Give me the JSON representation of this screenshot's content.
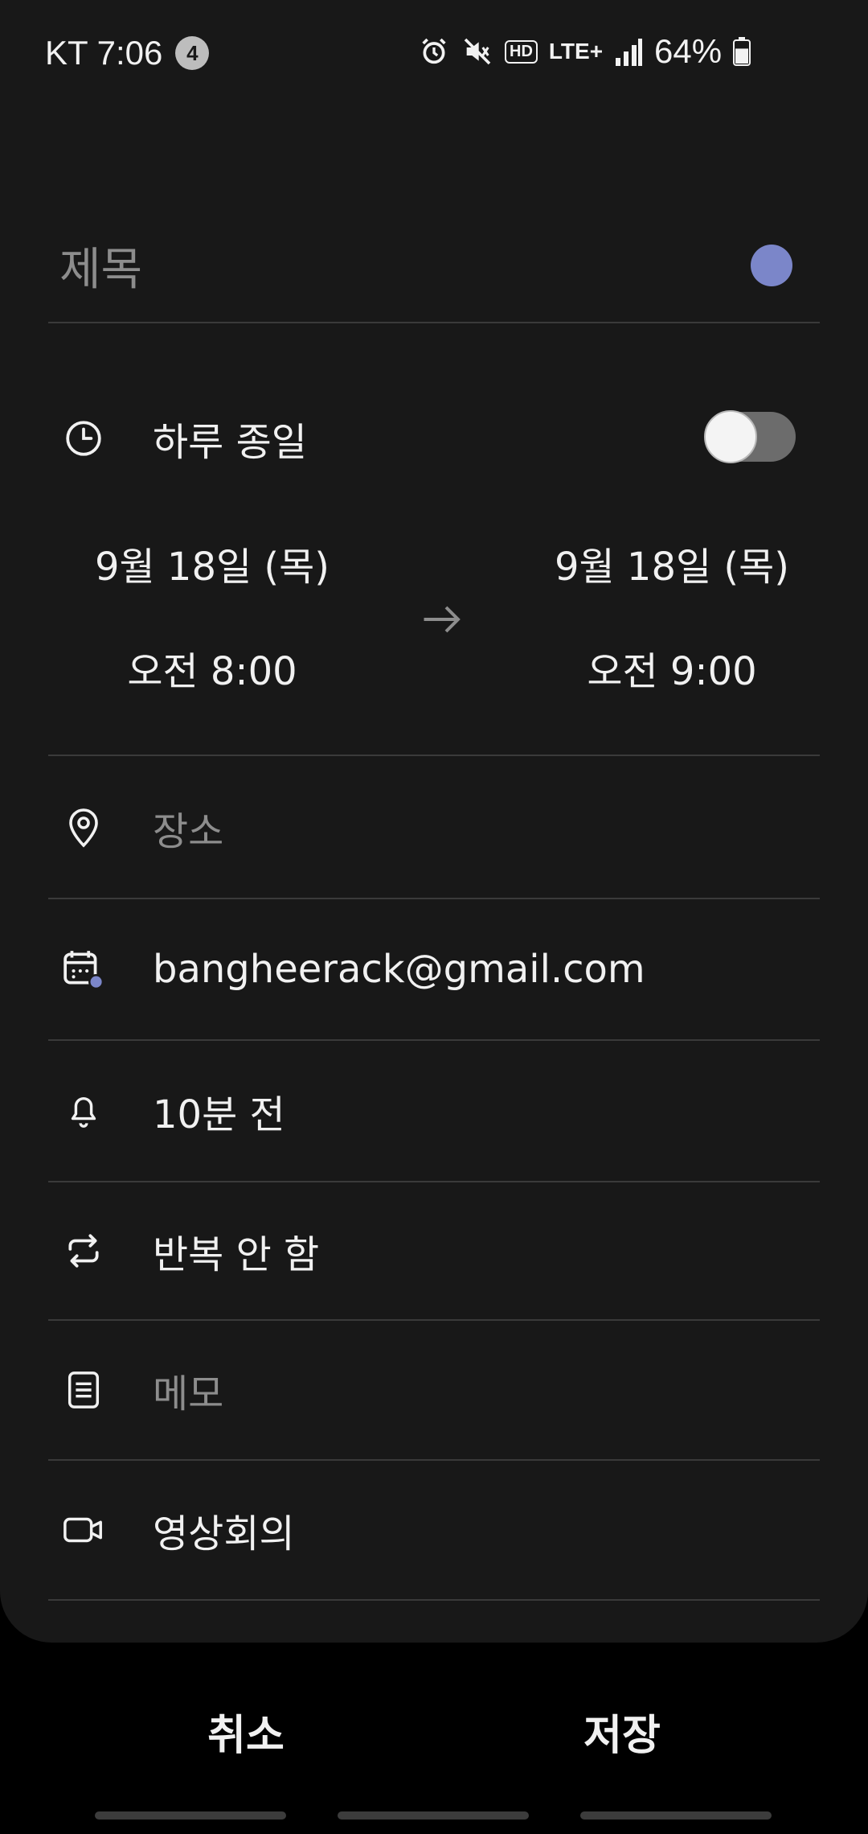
{
  "status_bar": {
    "carrier_time": "KT 7:06",
    "notification_count": "4",
    "network": "LTE+",
    "hd_label": "HD",
    "battery_percent": "64%",
    "battery_level": 0.64
  },
  "form": {
    "title_placeholder": "제목",
    "event_color": "#7b86c9",
    "all_day": {
      "label": "하루 종일",
      "enabled": false
    },
    "start": {
      "date": "9월 18일 (목)",
      "time": "오전 8:00"
    },
    "end": {
      "date": "9월 18일 (목)",
      "time": "오전 9:00"
    },
    "location_placeholder": "장소",
    "calendar_account": "bangheerack@gmail.com",
    "reminder": "10분 전",
    "repeat": "반복 안 함",
    "memo_placeholder": "메모",
    "video_conference": "영상회의"
  },
  "footer": {
    "cancel_label": "취소",
    "save_label": "저장"
  },
  "icons": {
    "all_day": "clock-icon",
    "location": "location-pin-icon",
    "calendar": "calendar-icon",
    "reminder": "bell-icon",
    "repeat": "repeat-icon",
    "memo": "memo-icon",
    "video": "video-camera-icon"
  }
}
